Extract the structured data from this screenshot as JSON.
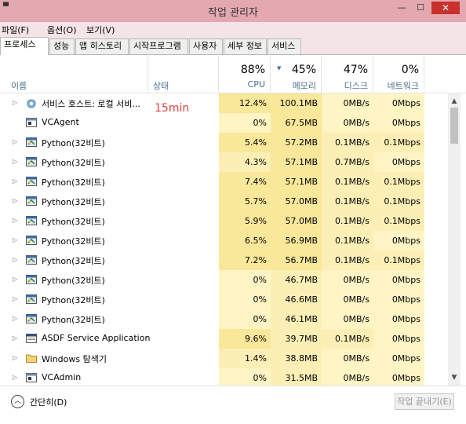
{
  "window": {
    "title": "작업 관리자",
    "system_icon": "app-icon",
    "min_glyph": "—",
    "max_glyph": "☐",
    "close_glyph": "✕"
  },
  "menu": [
    "파일(F)",
    "옵션(O)",
    "보기(V)"
  ],
  "tabs": [
    {
      "label": "프로세스",
      "active": true
    },
    {
      "label": "성능"
    },
    {
      "label": "앱 히스토리"
    },
    {
      "label": "시작프로그램"
    },
    {
      "label": "사용자"
    },
    {
      "label": "세부 정보"
    },
    {
      "label": "서비스"
    }
  ],
  "columns": {
    "name": "이름",
    "status": "상태",
    "cpu": {
      "pct": "88%",
      "label": "CPU"
    },
    "memory": {
      "pct": "45%",
      "label": "메모리"
    },
    "disk": {
      "pct": "47%",
      "label": "디스크"
    },
    "network": {
      "pct": "0%",
      "label": "네트워크"
    }
  },
  "annotation": "15min",
  "processes": [
    {
      "name": "서비스 호스트: 로컬 서비...",
      "icon": "gear-icon",
      "expand": true,
      "cpu": "12.4%",
      "memory": "100.1MB",
      "disk": "0MB/s",
      "network": "0Mbps"
    },
    {
      "name": "VCAgent",
      "icon": "window-icon",
      "expand": false,
      "cpu": "0%",
      "memory": "67.5MB",
      "disk": "0MB/s",
      "network": "0Mbps"
    },
    {
      "name": "Python(32비트)",
      "icon": "python-icon",
      "expand": true,
      "cpu": "5.4%",
      "memory": "57.2MB",
      "disk": "0.1MB/s",
      "network": "0.1Mbps"
    },
    {
      "name": "Python(32비트)",
      "icon": "python-icon",
      "expand": true,
      "cpu": "4.3%",
      "memory": "57.1MB",
      "disk": "0.7MB/s",
      "network": "0Mbps"
    },
    {
      "name": "Python(32비트)",
      "icon": "python-icon",
      "expand": true,
      "cpu": "7.4%",
      "memory": "57.1MB",
      "disk": "0.1MB/s",
      "network": "0.1Mbps"
    },
    {
      "name": "Python(32비트)",
      "icon": "python-icon",
      "expand": true,
      "cpu": "5.7%",
      "memory": "57.0MB",
      "disk": "0.1MB/s",
      "network": "0.1Mbps"
    },
    {
      "name": "Python(32비트)",
      "icon": "python-icon",
      "expand": true,
      "cpu": "5.9%",
      "memory": "57.0MB",
      "disk": "0.1MB/s",
      "network": "0.1Mbps"
    },
    {
      "name": "Python(32비트)",
      "icon": "python-icon",
      "expand": true,
      "cpu": "6.5%",
      "memory": "56.9MB",
      "disk": "0.1MB/s",
      "network": "0Mbps"
    },
    {
      "name": "Python(32비트)",
      "icon": "python-icon",
      "expand": true,
      "cpu": "7.2%",
      "memory": "56.7MB",
      "disk": "0.1MB/s",
      "network": "0.1Mbps"
    },
    {
      "name": "Python(32비트)",
      "icon": "python-icon",
      "expand": true,
      "cpu": "0%",
      "memory": "46.7MB",
      "disk": "0MB/s",
      "network": "0Mbps"
    },
    {
      "name": "Python(32비트)",
      "icon": "python-icon",
      "expand": true,
      "cpu": "0%",
      "memory": "46.6MB",
      "disk": "0MB/s",
      "network": "0Mbps"
    },
    {
      "name": "Python(32비트)",
      "icon": "python-icon",
      "expand": true,
      "cpu": "0%",
      "memory": "46.1MB",
      "disk": "0MB/s",
      "network": "0Mbps"
    },
    {
      "name": "ASDF Service Application",
      "icon": "service-app-icon",
      "expand": true,
      "cpu": "9.6%",
      "memory": "39.7MB",
      "disk": "0.1MB/s",
      "network": "0Mbps"
    },
    {
      "name": "Windows 탐색기",
      "icon": "folder-icon",
      "expand": true,
      "cpu": "1.4%",
      "memory": "38.8MB",
      "disk": "0MB/s",
      "network": "0Mbps"
    },
    {
      "name": "VCAdmin",
      "icon": "window-icon",
      "expand": true,
      "cpu": "0%",
      "memory": "31.5MB",
      "disk": "0MB/s",
      "network": "0Mbps"
    }
  ],
  "footer": {
    "fewer_details": "간단히(D)",
    "end_task": "작업 끝내기(E)",
    "fewer_glyph": "︿"
  },
  "scroll": {
    "up_glyph": "▲",
    "down_glyph": "▼"
  },
  "expand_glyph": "▷",
  "colors": {
    "titlebar": "#e3a8b0",
    "cell_high": "#f9e79a",
    "cell_mid": "#fcefb6",
    "cell_low": "#fff4c4",
    "annotation": "#e0413a",
    "header_label": "#4d6f91"
  }
}
